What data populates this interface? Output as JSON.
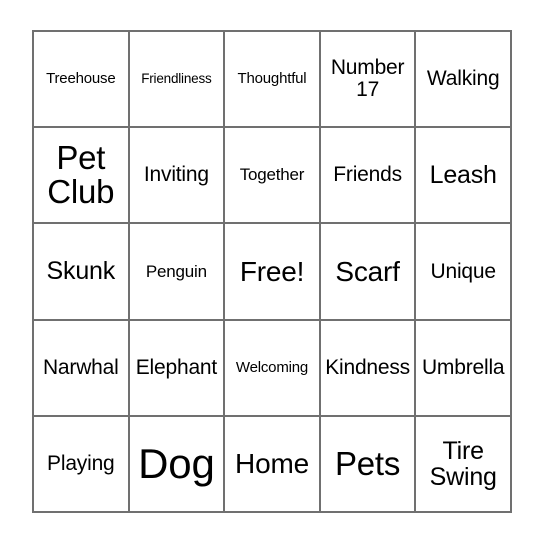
{
  "card": {
    "type": "bingo-card",
    "rows": 5,
    "columns": 5,
    "border_color": "#707070",
    "background_color": "#ffffff",
    "text_color": "#000000",
    "cells": [
      {
        "text": "Treehouse",
        "size": "xs",
        "row": 1,
        "col": 1
      },
      {
        "text": "Friendliness",
        "size": "xxs",
        "row": 1,
        "col": 2
      },
      {
        "text": "Thoughtful",
        "size": "xs",
        "row": 1,
        "col": 3
      },
      {
        "text": "Number\n17",
        "size": "m",
        "row": 1,
        "col": 4
      },
      {
        "text": "Walking",
        "size": "m",
        "row": 1,
        "col": 5
      },
      {
        "text": "Pet\nClub",
        "size": "xxl",
        "row": 2,
        "col": 1
      },
      {
        "text": "Inviting",
        "size": "m",
        "row": 2,
        "col": 2
      },
      {
        "text": "Together",
        "size": "s",
        "row": 2,
        "col": 3
      },
      {
        "text": "Friends",
        "size": "m",
        "row": 2,
        "col": 4
      },
      {
        "text": "Leash",
        "size": "l",
        "row": 2,
        "col": 5
      },
      {
        "text": "Skunk",
        "size": "l",
        "row": 3,
        "col": 1
      },
      {
        "text": "Penguin",
        "size": "s",
        "row": 3,
        "col": 2
      },
      {
        "text": "Free!",
        "size": "xl",
        "row": 3,
        "col": 3
      },
      {
        "text": "Scarf",
        "size": "xl",
        "row": 3,
        "col": 4
      },
      {
        "text": "Unique",
        "size": "m",
        "row": 3,
        "col": 5
      },
      {
        "text": "Narwhal",
        "size": "m",
        "row": 4,
        "col": 1
      },
      {
        "text": "Elephant",
        "size": "m",
        "row": 4,
        "col": 2
      },
      {
        "text": "Welcoming",
        "size": "xs",
        "row": 4,
        "col": 3
      },
      {
        "text": "Kindness",
        "size": "m",
        "row": 4,
        "col": 4
      },
      {
        "text": "Umbrella",
        "size": "m",
        "row": 4,
        "col": 5
      },
      {
        "text": "Playing",
        "size": "m",
        "row": 5,
        "col": 1
      },
      {
        "text": "Dog",
        "size": "huge",
        "row": 5,
        "col": 2
      },
      {
        "text": "Home",
        "size": "xl",
        "row": 5,
        "col": 3
      },
      {
        "text": "Pets",
        "size": "xxl",
        "row": 5,
        "col": 4
      },
      {
        "text": "Tire\nSwing",
        "size": "l",
        "row": 5,
        "col": 5
      }
    ]
  }
}
